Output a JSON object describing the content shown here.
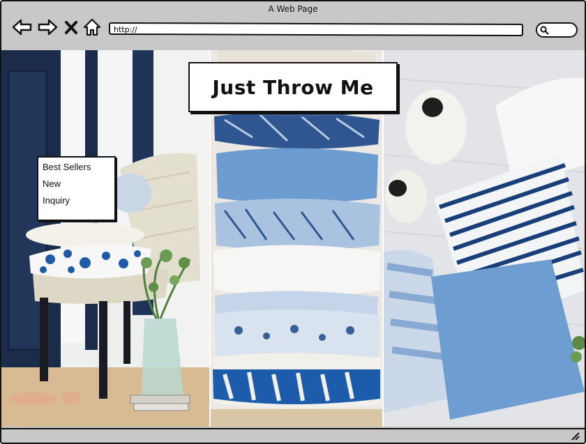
{
  "window": {
    "title": "A Web Page"
  },
  "toolbar": {
    "back_icon": "arrow-left-icon",
    "forward_icon": "arrow-right-icon",
    "stop_icon": "close-icon",
    "home_icon": "home-icon",
    "url_value": "http://",
    "search_icon": "search-icon"
  },
  "page": {
    "headline": "Just Throw Me",
    "menu": [
      {
        "label": "Best Sellers"
      },
      {
        "label": "New"
      },
      {
        "label": "Inquiry"
      }
    ]
  },
  "colors": {
    "chrome": "#c8c8c8",
    "navy": "#1a3b73",
    "cushion_blue": "#6e9ed1",
    "chair_cream": "#dcd8c8",
    "floor_wood": "#d8b991",
    "background_gray": "#e4e6e8"
  }
}
